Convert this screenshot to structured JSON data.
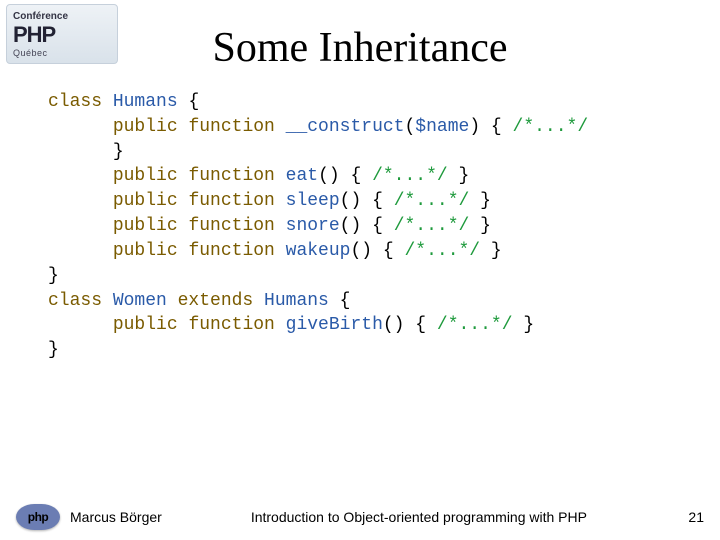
{
  "badge": {
    "line1": "Conférence",
    "line2": "PHP",
    "line3": "Québec"
  },
  "title": "Some Inheritance",
  "code": {
    "l1": {
      "kw1": "class ",
      "ty": "Humans ",
      "p": "{"
    },
    "l2": {
      "pad": "      ",
      "kw1": "public ",
      "kw2": "function ",
      "fn": "__construct",
      "p1": "(",
      "va": "$name",
      "p2": ") { ",
      "cm": "/*...*/"
    },
    "l3": {
      "pad": "      ",
      "p": "}"
    },
    "l4": {
      "pad": "      ",
      "kw1": "public ",
      "kw2": "function ",
      "fn": "eat",
      "p1": "() { ",
      "cm": "/*...*/",
      "p2": " }"
    },
    "l5": {
      "pad": "      ",
      "kw1": "public ",
      "kw2": "function ",
      "fn": "sleep",
      "p1": "() { ",
      "cm": "/*...*/",
      "p2": " }"
    },
    "l6": {
      "pad": "      ",
      "kw1": "public ",
      "kw2": "function ",
      "fn": "snore",
      "p1": "() { ",
      "cm": "/*...*/",
      "p2": " }"
    },
    "l7": {
      "pad": "      ",
      "kw1": "public ",
      "kw2": "function ",
      "fn": "wakeup",
      "p1": "() { ",
      "cm": "/*...*/",
      "p2": " }"
    },
    "l8": {
      "p": "}"
    },
    "l9": {
      "kw1": "class ",
      "ty": "Women ",
      "kw2": "extends ",
      "ty2": "Humans ",
      "p": "{"
    },
    "l10": {
      "pad": "      ",
      "kw1": "public ",
      "kw2": "function ",
      "fn": "giveBirth",
      "p1": "() { ",
      "cm": "/*...*/",
      "p2": " }"
    },
    "l11": {
      "p": "}"
    }
  },
  "footer": {
    "php": "php",
    "author": "Marcus Börger",
    "title": "Introduction to Object-oriented programming with PHP",
    "page": "21"
  }
}
